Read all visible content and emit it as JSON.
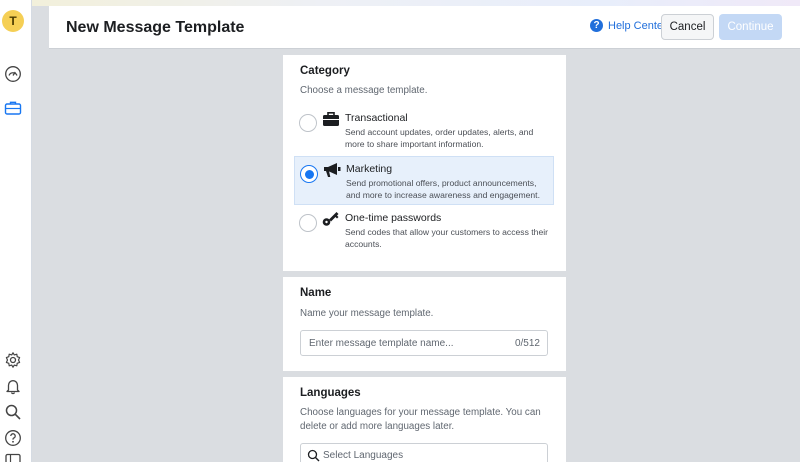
{
  "rail": {
    "avatar_letter": "T",
    "top_icons": [
      "dashboard-gauge-icon",
      "briefcase-icon"
    ],
    "bottom_icons": [
      "settings-gear-icon",
      "bell-icon",
      "search-icon",
      "help-icon",
      "panel-icon"
    ]
  },
  "header": {
    "title": "New Message Template",
    "help_label": "Help Center",
    "help_glyph": "?",
    "cancel_label": "Cancel",
    "continue_label": "Continue"
  },
  "category": {
    "title": "Category",
    "subtitle": "Choose a message template.",
    "selected": "marketing",
    "options": [
      {
        "id": "transactional",
        "title": "Transactional",
        "desc": "Send account updates, order updates, alerts, and more to share important information.",
        "icon": "briefcase-icon"
      },
      {
        "id": "marketing",
        "title": "Marketing",
        "desc": "Send promotional offers, product announcements, and more to increase awareness and engagement.",
        "icon": "megaphone-icon"
      },
      {
        "id": "otp",
        "title": "One-time passwords",
        "desc": "Send codes that allow your customers to access their accounts.",
        "icon": "key-icon"
      }
    ]
  },
  "name": {
    "title": "Name",
    "subtitle": "Name your message template.",
    "placeholder": "Enter message template name...",
    "counter": "0/512"
  },
  "languages": {
    "title": "Languages",
    "subtitle": "Choose languages for your message template. You can delete or add more languages later.",
    "placeholder": "Select Languages"
  },
  "colors": {
    "accent": "#1877f2",
    "link": "#216fdb",
    "avatar": "#f5cf55",
    "selected_bg": "#e7f0fb",
    "canvas": "#dadde1"
  }
}
